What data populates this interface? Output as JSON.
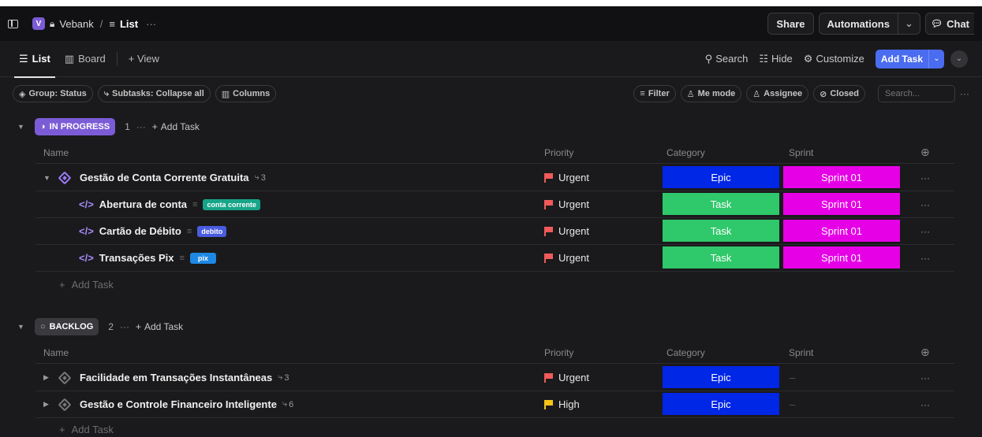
{
  "topbar": {
    "space_initial": "V",
    "space_name": "Vebank",
    "separator": "/",
    "list_name": "List",
    "more": "···",
    "share_label": "Share",
    "automations_label": "Automations",
    "chat_label": "Chat"
  },
  "viewbar": {
    "tab_list": "List",
    "tab_board": "Board",
    "add_view": "+ View",
    "search_label": "Search",
    "hide_label": "Hide",
    "customize_label": "Customize",
    "add_task_label": "Add Task"
  },
  "filterbar": {
    "group_label": "Group: Status",
    "subtasks_label": "Subtasks: Collapse all",
    "columns_label": "Columns",
    "filter_label": "Filter",
    "me_mode_label": "Me mode",
    "assignee_label": "Assignee",
    "closed_label": "Closed",
    "search_placeholder": "Search...",
    "more": "···"
  },
  "columns": {
    "name": "Name",
    "priority": "Priority",
    "category": "Category",
    "sprint": "Sprint"
  },
  "groups": [
    {
      "status": "IN PROGRESS",
      "count": "1",
      "more": "···",
      "add_task": "Add Task",
      "color": "#7b5cd6",
      "rows": [
        {
          "name": "Gestão de Conta Corrente Gratuita",
          "subtasks": "3",
          "priority": "Urgent",
          "category": "Epic",
          "sprint": "Sprint 01",
          "more": "···"
        },
        {
          "name": "Abertura de conta",
          "tag": "conta corrente",
          "priority": "Urgent",
          "category": "Task",
          "sprint": "Sprint 01",
          "more": "···"
        },
        {
          "name": "Cartão de Débito",
          "tag": "debito",
          "priority": "Urgent",
          "category": "Task",
          "sprint": "Sprint 01",
          "more": "···"
        },
        {
          "name": "Transações Pix",
          "tag": "pix",
          "priority": "Urgent",
          "category": "Task",
          "sprint": "Sprint 01",
          "more": "···"
        }
      ],
      "add_row": "Add Task"
    },
    {
      "status": "BACKLOG",
      "count": "2",
      "more": "···",
      "add_task": "Add Task",
      "color": "#3a3a3e",
      "rows": [
        {
          "name": "Facilidade em Transações Instantâneas",
          "subtasks": "3",
          "priority": "Urgent",
          "category": "Epic",
          "sprint": "–",
          "more": "···"
        },
        {
          "name": "Gestão e Controle Financeiro Inteligente",
          "subtasks": "6",
          "priority": "High",
          "category": "Epic",
          "sprint": "–",
          "more": "···"
        }
      ],
      "add_row": "Add Task"
    }
  ],
  "colors": {
    "epic": "#0026e6",
    "task": "#2fc86a",
    "sprint": "#e600e6",
    "urgent_flag": "#f05a5a",
    "high_flag": "#f5c518",
    "tag_conta_corrente": "#17a589",
    "tag_debito": "#4a5ce0",
    "tag_pix": "#1e88e5"
  }
}
